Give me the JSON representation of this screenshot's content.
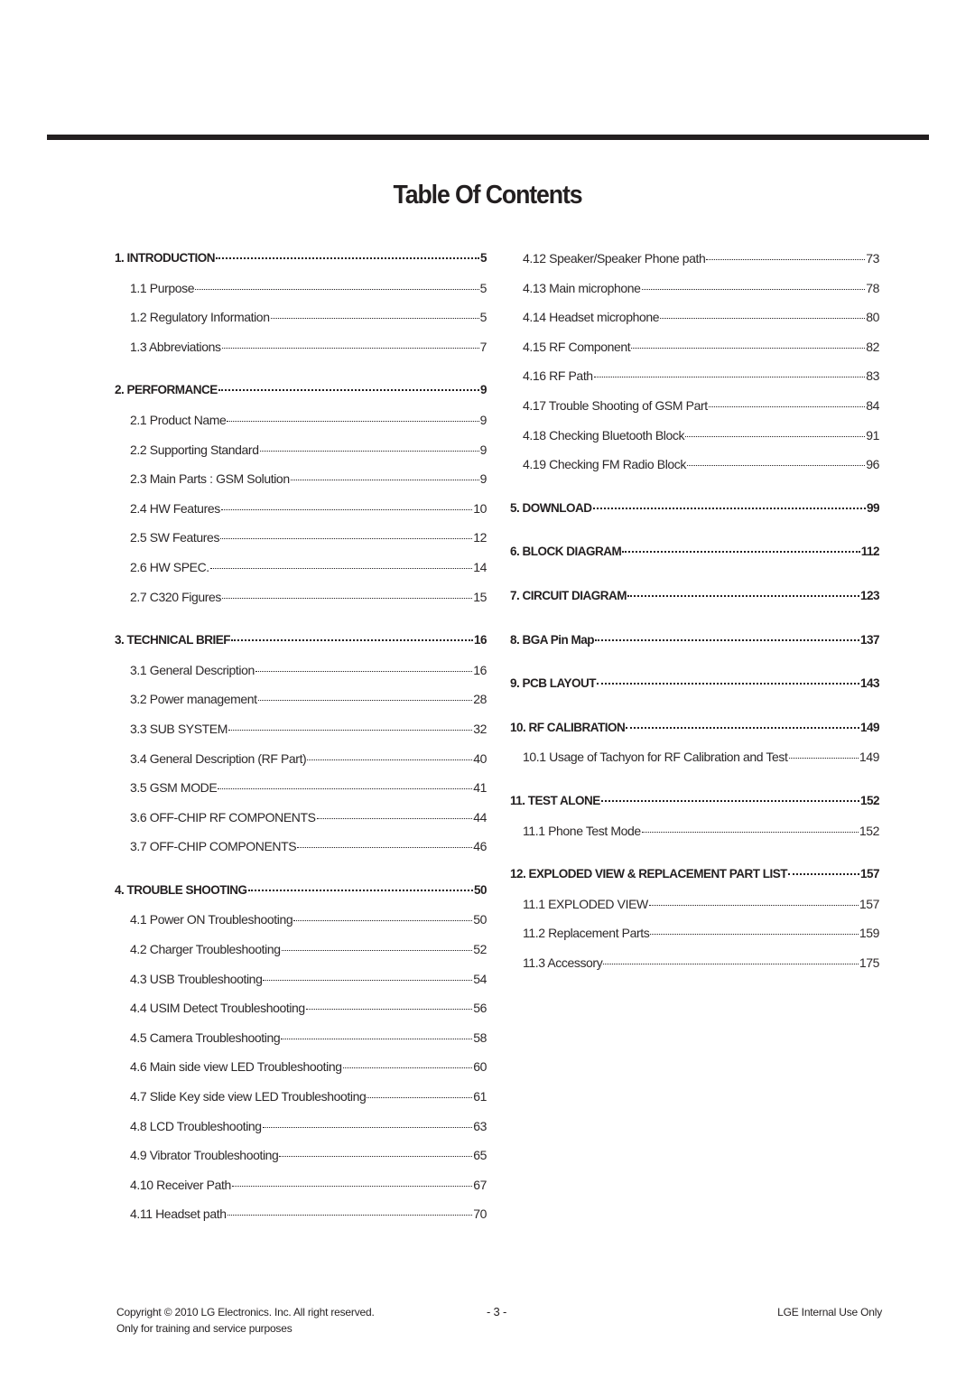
{
  "document": {
    "title": "Table Of Contents"
  },
  "toc": {
    "left": [
      {
        "type": "section",
        "label": "1. INTRODUCTION",
        "page": "5"
      },
      {
        "type": "sub",
        "label": "1.1 Purpose",
        "page": "5"
      },
      {
        "type": "sub",
        "label": "1.2 Regulatory Information",
        "page": "5"
      },
      {
        "type": "sub",
        "label": "1.3 Abbreviations",
        "page": "7"
      },
      {
        "type": "section",
        "label": "2. PERFORMANCE",
        "page": "9"
      },
      {
        "type": "sub",
        "label": "2.1 Product Name",
        "page": "9"
      },
      {
        "type": "sub",
        "label": "2.2 Supporting Standard",
        "page": "9"
      },
      {
        "type": "sub",
        "label": "2.3 Main Parts : GSM Solution",
        "page": "9"
      },
      {
        "type": "sub",
        "label": "2.4 HW Features",
        "page": "10"
      },
      {
        "type": "sub",
        "label": "2.5 SW Features",
        "page": "12"
      },
      {
        "type": "sub",
        "label": "2.6 HW SPEC.",
        "page": "14"
      },
      {
        "type": "sub",
        "label": "2.7 C320 Figures",
        "page": "15"
      },
      {
        "type": "section",
        "label": "3. TECHNICAL BRIEF",
        "page": "16"
      },
      {
        "type": "sub",
        "label": "3.1 General Description",
        "page": "16"
      },
      {
        "type": "sub",
        "label": "3.2 Power management",
        "page": "28"
      },
      {
        "type": "sub",
        "label": "3.3 SUB SYSTEM",
        "page": "32"
      },
      {
        "type": "sub",
        "label": "3.4 General Description (RF Part)",
        "page": "40"
      },
      {
        "type": "sub",
        "label": "3.5 GSM MODE",
        "page": "41"
      },
      {
        "type": "sub",
        "label": "3.6 OFF-CHIP RF COMPONENTS",
        "page": "44"
      },
      {
        "type": "sub",
        "label": "3.7 OFF-CHIP COMPONENTS",
        "page": "46"
      },
      {
        "type": "section",
        "label": "4. TROUBLE SHOOTING",
        "page": "50"
      },
      {
        "type": "sub",
        "label": "4.1 Power ON Troubleshooting",
        "page": "50"
      },
      {
        "type": "sub",
        "label": "4.2 Charger Troubleshooting",
        "page": "52"
      },
      {
        "type": "sub",
        "label": "4.3 USB Troubleshooting",
        "page": "54"
      },
      {
        "type": "sub",
        "label": "4.4 USIM Detect Troubleshooting",
        "page": "56"
      },
      {
        "type": "sub",
        "label": "4.5 Camera Troubleshooting",
        "page": "58"
      },
      {
        "type": "sub",
        "label": "4.6 Main side view LED Troubleshooting",
        "page": "60"
      },
      {
        "type": "sub",
        "label": "4.7 Slide Key side view LED Troubleshooting",
        "page": "61"
      },
      {
        "type": "sub",
        "label": "4.8 LCD Troubleshooting",
        "page": "63"
      },
      {
        "type": "sub",
        "label": "4.9 Vibrator Troubleshooting",
        "page": "65"
      },
      {
        "type": "sub",
        "label": "4.10 Receiver Path",
        "page": "67"
      },
      {
        "type": "sub",
        "label": "4.11 Headset path",
        "page": "70"
      }
    ],
    "right": [
      {
        "type": "sub",
        "label": "4.12 Speaker/Speaker Phone path",
        "page": "73"
      },
      {
        "type": "sub",
        "label": "4.13 Main microphone",
        "page": "78"
      },
      {
        "type": "sub",
        "label": "4.14 Headset microphone",
        "page": "80"
      },
      {
        "type": "sub",
        "label": "4.15 RF Component",
        "page": "82"
      },
      {
        "type": "sub",
        "label": "4.16 RF Path",
        "page": "83"
      },
      {
        "type": "sub",
        "label": "4.17 Trouble Shooting of GSM Part",
        "page": "84"
      },
      {
        "type": "sub",
        "label": "4.18 Checking Bluetooth Block",
        "page": "91"
      },
      {
        "type": "sub",
        "label": "4.19 Checking FM Radio Block",
        "page": "96"
      },
      {
        "type": "section",
        "label": "5. DOWNLOAD",
        "page": "99"
      },
      {
        "type": "section",
        "label": "6. BLOCK DIAGRAM",
        "page": "112"
      },
      {
        "type": "section",
        "label": "7. CIRCUIT DIAGRAM",
        "page": "123"
      },
      {
        "type": "section",
        "label": "8. BGA Pin Map",
        "page": "137"
      },
      {
        "type": "section",
        "label": "9. PCB LAYOUT",
        "page": "143"
      },
      {
        "type": "section",
        "label": "10. RF CALIBRATION",
        "page": "149"
      },
      {
        "type": "sub",
        "label": "10.1 Usage of Tachyon for RF Calibration and Test",
        "page": "149"
      },
      {
        "type": "section",
        "label": "11. TEST ALONE",
        "page": "152"
      },
      {
        "type": "sub",
        "label": "11.1 Phone Test Mode",
        "page": "152"
      },
      {
        "type": "section",
        "label": "12. EXPLODED VIEW & REPLACEMENT PART LIST",
        "page": "157"
      },
      {
        "type": "sub",
        "label": "11.1 EXPLODED VIEW",
        "page": "157"
      },
      {
        "type": "sub",
        "label": "11.2 Replacement Parts",
        "page": "159"
      },
      {
        "type": "sub",
        "label": "11.3 Accessory",
        "page": "175"
      }
    ]
  },
  "footer": {
    "copyright": "Copyright © 2010 LG Electronics. Inc. All right reserved.",
    "usage_note": "Only for training and service purposes",
    "page_number": "- 3 -",
    "classification": "LGE Internal Use Only"
  }
}
